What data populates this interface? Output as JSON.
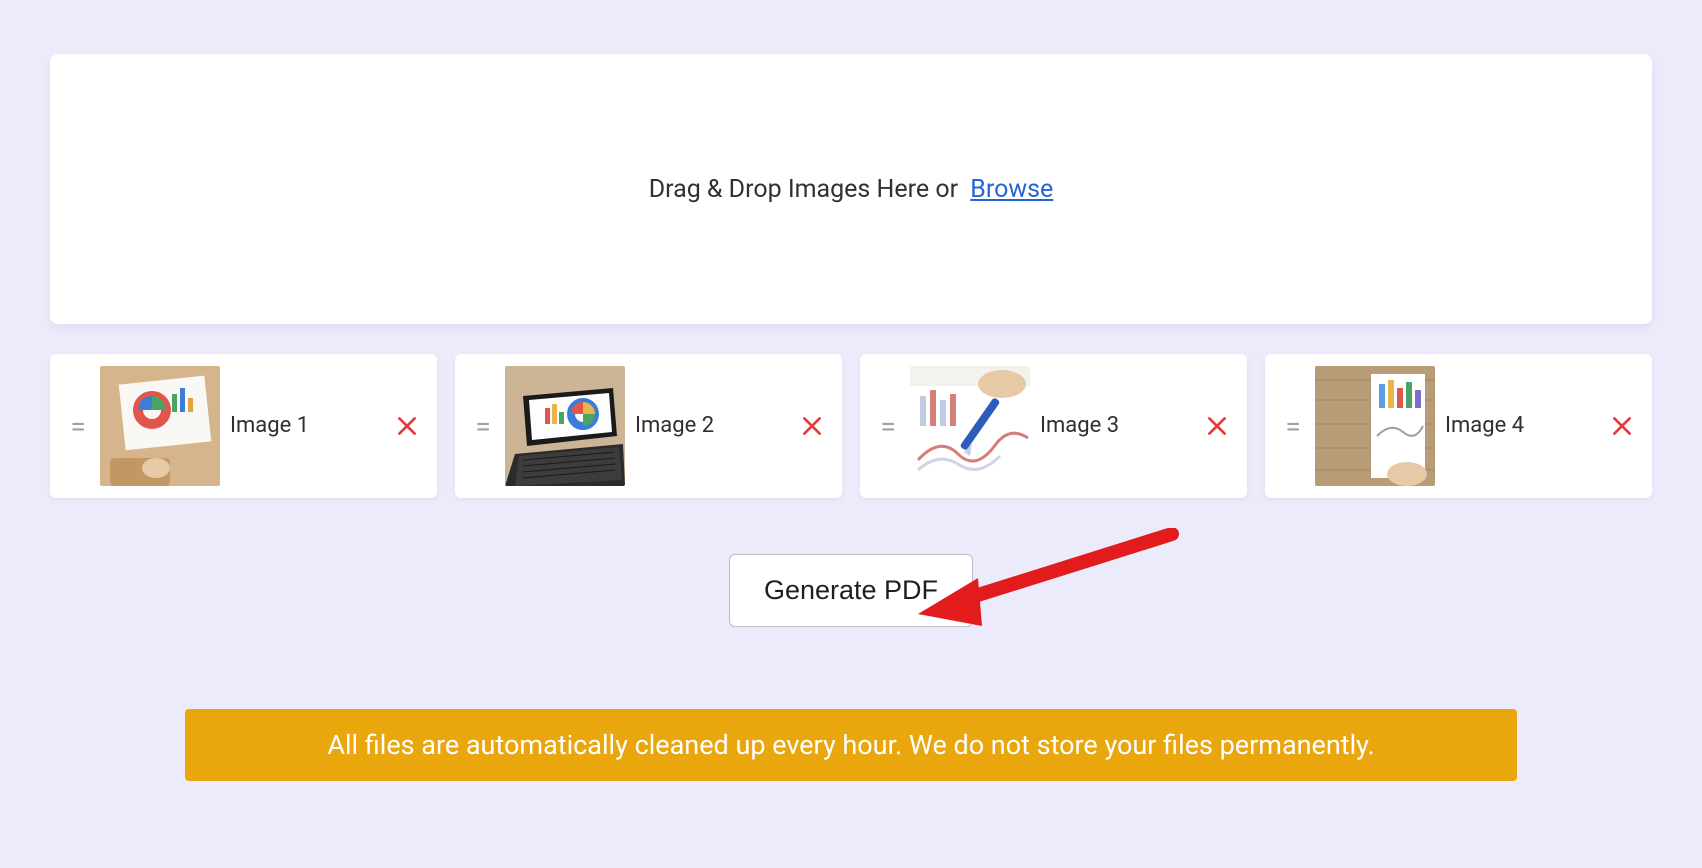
{
  "dropzone": {
    "text": "Drag & Drop Images Here or",
    "browse": "Browse"
  },
  "images": [
    {
      "label": "Image 1"
    },
    {
      "label": "Image 2"
    },
    {
      "label": "Image 3"
    },
    {
      "label": "Image 4"
    }
  ],
  "actions": {
    "generate": "Generate PDF"
  },
  "notice": "All files are automatically cleaned up every hour. We do not store your files permanently."
}
